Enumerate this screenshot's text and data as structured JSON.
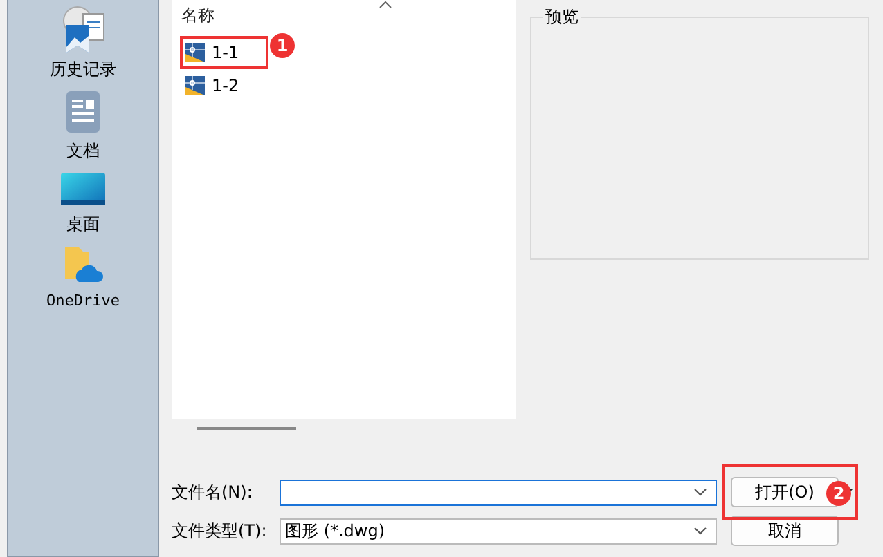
{
  "sidebar": {
    "items": [
      {
        "kind": "history",
        "label": "历史记录"
      },
      {
        "kind": "documents",
        "label": "文档"
      },
      {
        "kind": "desktop",
        "label": "桌面"
      },
      {
        "kind": "cloud",
        "label": "OneDrive"
      }
    ]
  },
  "file_list": {
    "column": "名称",
    "files": [
      {
        "name": "1-1",
        "highlighted": true
      },
      {
        "name": "1-2",
        "highlighted": false
      }
    ]
  },
  "preview": {
    "title": "预览"
  },
  "file_name": {
    "label": "文件名(N):"
  },
  "file_type": {
    "label": "文件类型(T):",
    "value": "图形 (*.dwg)"
  },
  "buttons": {
    "open": "打开(O)",
    "cancel": "取消"
  },
  "open_highlighted": true,
  "markers": [
    {
      "number": "1"
    },
    {
      "number": "2"
    }
  ]
}
